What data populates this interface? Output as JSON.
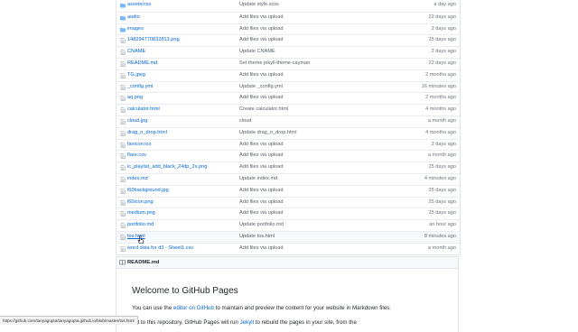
{
  "files": [
    {
      "type": "folder",
      "icon": "folder-icon",
      "name": "assets/css",
      "message": "Update style.scss",
      "age": "a day ago"
    },
    {
      "type": "folder",
      "icon": "folder-icon",
      "name": "audio",
      "message": "Add files via upload",
      "age": "22 days ago"
    },
    {
      "type": "folder",
      "icon": "folder-icon",
      "name": "images",
      "message": "Add files via upload",
      "age": "2 days ago"
    },
    {
      "type": "file",
      "icon": "file-icon",
      "name": "148294770832813.png",
      "message": "Add files via upload",
      "age": "25 days ago"
    },
    {
      "type": "file",
      "icon": "file-icon",
      "name": "CNAME",
      "message": "Update CNAME",
      "age": "2 days ago"
    },
    {
      "type": "file",
      "icon": "file-icon",
      "name": "README.md",
      "message": "Set theme jekyll-theme-cayman",
      "age": "22 days ago"
    },
    {
      "type": "file",
      "icon": "file-icon",
      "name": "TG.jpeg",
      "message": "Add files via upload",
      "age": "2 months ago"
    },
    {
      "type": "file",
      "icon": "file-icon",
      "name": "_config.yml",
      "message": "Update _config.yml",
      "age": "16 minutes ago"
    },
    {
      "type": "file",
      "icon": "file-icon",
      "name": "aq.png",
      "message": "Add files via upload",
      "age": "2 months ago"
    },
    {
      "type": "file",
      "icon": "file-icon",
      "name": "calculator.html",
      "message": "Create calculator.html",
      "age": "4 months ago"
    },
    {
      "type": "file",
      "icon": "file-icon",
      "name": "cloud.jpg",
      "message": "cloud",
      "age": "a month ago"
    },
    {
      "type": "file",
      "icon": "file-icon",
      "name": "drag_n_drop.html",
      "message": "Update drag_n_drop.html",
      "age": "4 months ago"
    },
    {
      "type": "file",
      "icon": "file-icon",
      "name": "favicon.ico",
      "message": "Add files via upload",
      "age": "2 days ago"
    },
    {
      "type": "file",
      "icon": "file-icon",
      "name": "flare.csv",
      "message": "Add files via upload",
      "age": "a month ago"
    },
    {
      "type": "file",
      "icon": "file-icon",
      "name": "ic_playlist_add_black_24dp_2x.png",
      "message": "Add files via upload",
      "age": "25 days ago"
    },
    {
      "type": "file",
      "icon": "file-icon",
      "name": "index.md",
      "message": "Update index.md",
      "age": "4 minutes ago"
    },
    {
      "type": "file",
      "icon": "file-icon",
      "name": "l60background.jpg",
      "message": "Add files via upload",
      "age": "25 days ago"
    },
    {
      "type": "file",
      "icon": "file-icon",
      "name": "l60icon.png",
      "message": "Add files via upload",
      "age": "25 days ago"
    },
    {
      "type": "file",
      "icon": "file-icon",
      "name": "medium.png",
      "message": "Add files via upload",
      "age": "25 days ago"
    },
    {
      "type": "file",
      "icon": "file-icon",
      "name": "portfolio.md",
      "message": "Update portfolio.md",
      "age": "an hour ago"
    },
    {
      "type": "file",
      "icon": "file-icon",
      "name": "tos.html",
      "message": "Update tos.html",
      "age": "8 minutes ago",
      "hover": true
    },
    {
      "type": "file",
      "icon": "file-icon",
      "name": "word data for d3 - Sheet1.csv",
      "message": "Add files via upload",
      "age": "a month ago"
    }
  ],
  "readme": {
    "bar_icon": "book-icon",
    "bar_title": "README.md",
    "heading": "Welcome to GitHub Pages",
    "para_prefix": "You can use the ",
    "para_link": "editor on GitHub",
    "para_suffix": " to maintain and preview the content for your website in Markdown files.",
    "para2_prefix": "mit to this repository, GitHub Pages will run ",
    "para2_link": "Jekyll",
    "para2_suffix": " to rebuild the pages in your site, from the"
  },
  "status_bar": {
    "url": "https://github.com/tanyagupta/tanyagupta.github.io/blob/master/tos.html"
  },
  "colors": {
    "link": "#0366d6",
    "folder": "#79b8ff",
    "muted": "#6a737d"
  }
}
